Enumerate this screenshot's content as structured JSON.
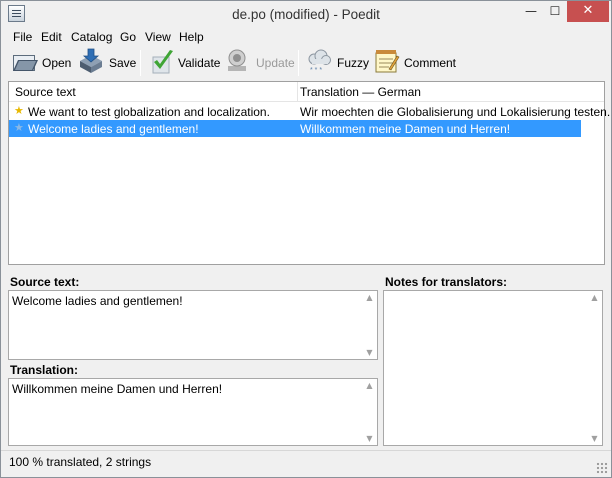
{
  "window": {
    "title": "de.po (modified) - Poedit"
  },
  "titlebar_buttons": {
    "minimize": "—",
    "maximize": "☐",
    "close": "✕"
  },
  "menu": [
    "File",
    "Edit",
    "Catalog",
    "Go",
    "View",
    "Help"
  ],
  "toolbar": {
    "open": "Open",
    "save": "Save",
    "validate": "Validate",
    "update": "Update",
    "fuzzy": "Fuzzy",
    "comment": "Comment"
  },
  "list": {
    "headers": {
      "source": "Source text",
      "translation": "Translation — German"
    },
    "rows": [
      {
        "source": "We want to test globalization and localization.",
        "translation": "Wir moechten die Globalisierung und Lokalisierung testen.",
        "star": "★",
        "star_color": "#e8b800",
        "selected": false
      },
      {
        "source": "Welcome ladies and gentlemen!",
        "translation": "Willkommen meine Damen und Herren!",
        "star": "★",
        "star_color": "#8ab8e6",
        "selected": true
      }
    ]
  },
  "panes": {
    "source_label": "Source text:",
    "source_value": "Welcome ladies and gentlemen!",
    "translation_label": "Translation:",
    "translation_value": "Willkommen meine Damen und Herren!",
    "notes_label": "Notes for translators:",
    "notes_value": ""
  },
  "scroll_arrows": {
    "up": "▲",
    "down": "▼"
  },
  "status": "100 % translated, 2 strings",
  "colors": {
    "selection": "#3399ff",
    "close_button": "#c75050"
  }
}
